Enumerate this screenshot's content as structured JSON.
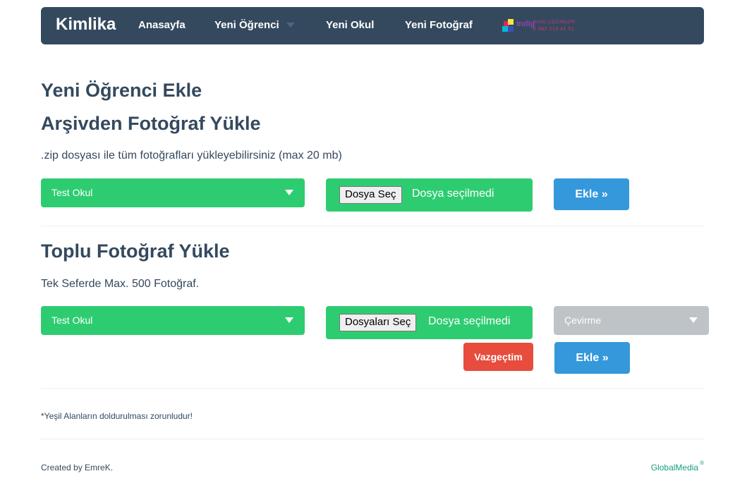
{
  "navbar": {
    "brand": "Kimlika",
    "items": [
      {
        "label": "Anasayfa"
      },
      {
        "label": "Yeni Öğrenci"
      },
      {
        "label": "Yeni Okul"
      },
      {
        "label": "Yeni Fotoğraf"
      }
    ],
    "logo": {
      "word": "Indig",
      "small_text": "BASKI ÇÖZÜMLERİ",
      "phone": "0 382 213 41 51",
      "colors": [
        "#e91e63",
        "#ffeb3b",
        "#00bcd4",
        "#3f51b5"
      ]
    }
  },
  "headings": {
    "main": "Yeni Öğrenci Ekle",
    "archive": "Arşivden Fotoğraf Yükle",
    "bulk": "Toplu Fotoğraf Yükle"
  },
  "archive_section": {
    "description": ".zip dosyası ile tüm fotoğrafları yükleyebilirsiniz (max 20 mb)",
    "school_select": "Test Okul",
    "file_button": "Dosya Seç",
    "file_status": "Dosya seçilmedi",
    "submit": "Ekle »"
  },
  "bulk_section": {
    "description": "Tek Seferde Max. 500 Fotoğraf.",
    "school_select": "Test Okul",
    "file_button": "Dosyaları Seç",
    "file_status": "Dosya seçilmedi",
    "rotate_select": "Çevirme",
    "cancel": "Vazgeçtim",
    "submit": "Ekle »"
  },
  "note": "*Yeşil Alanların doldurulması zorunludur!",
  "footer": {
    "created_by": "Created by EmreK.",
    "brand": "GlobalMedia",
    "registered": "®"
  },
  "colors": {
    "navbar": "#34495e",
    "green": "#2ecc71",
    "blue": "#3498db",
    "red": "#e74c3c",
    "grey": "#bdc3c7",
    "footer_link": "#16a085"
  }
}
